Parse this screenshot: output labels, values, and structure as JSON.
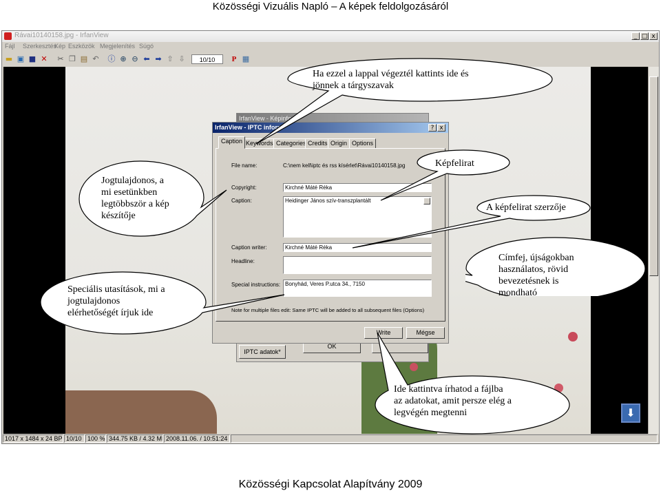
{
  "slide": {
    "title": "Közösségi Vizuális Napló – A képek feldolgozásáról",
    "footer": "Közösségi Kapcsolat Alapítvány 2009"
  },
  "window": {
    "title": "Rávai10140158.jpg - IrfanView",
    "controls": [
      "_",
      "□",
      "x"
    ],
    "menu": [
      "Fájl",
      "Szerkesztés",
      "Kép",
      "Eszközök",
      "Megjelenítés",
      "Súgó"
    ],
    "page_counter": "10/10"
  },
  "status_bar": {
    "cells": [
      "1017 x 1484 x 24 BPP",
      "10/10",
      "100 %",
      "344.75 KB / 4.32 MB",
      "2008.11.06. / 10:51:24"
    ]
  },
  "dialog_back": {
    "title": "IrfanView - Képinfo",
    "iptc_button": "IPTC adatok*",
    "ok_button": "OK"
  },
  "dialog": {
    "title": "IrfanView - IPTC inform",
    "tabs": [
      "Caption",
      "Keywords",
      "Categories",
      "Credits",
      "Origin",
      "Options"
    ],
    "active_tab": "Caption",
    "labels": {
      "file_name": "File name:",
      "copyright": "Copyright:",
      "caption": "Caption:",
      "caption_writer": "Caption writer:",
      "headline": "Headline:",
      "special_instructions": "Special instructions:"
    },
    "values": {
      "file_name": "C:\\nem kell\\iptc és rss kísérlet\\Rávai10140158.jpg",
      "copyright": "Kirchné Máté Réka",
      "caption": "Heidinger János szív-transzplantált",
      "caption_writer": "Kirchné Máté Réka",
      "headline": "",
      "special_instructions": "Bonyhád, Veres P.utca 34., 7150"
    },
    "note": "Note for multiple files edit: Same IPTC will be added to all subsequent files (Options)",
    "write_button": "Write",
    "cancel_button": "Mégse"
  },
  "callouts": {
    "top": "Ha ezzel a lappal végeztél kattints ide és\njönnek a tárgyszavak",
    "copyright": "Jogtulajdonos, a\nmi esetünkben\nlegtöbbször a kép\nkészítője",
    "caption": "Képfelirat",
    "caption_writer": "A képfelirat szerzője",
    "headline": "Címfej, újságokban\nhasználatos, rövid\nbevezetésnek is\nmondható",
    "instructions": "Speciális utasítások, mi a\njogtulajdonos\nelérhetőségét írjuk ide",
    "write": "Ide kattintva írhatod a fájlba\naz adatokat, amit persze elég a\nlegvégén megtenni"
  },
  "colors": {
    "dialog_title_active": "#0a246a",
    "window_face": "#d4d0c8"
  }
}
